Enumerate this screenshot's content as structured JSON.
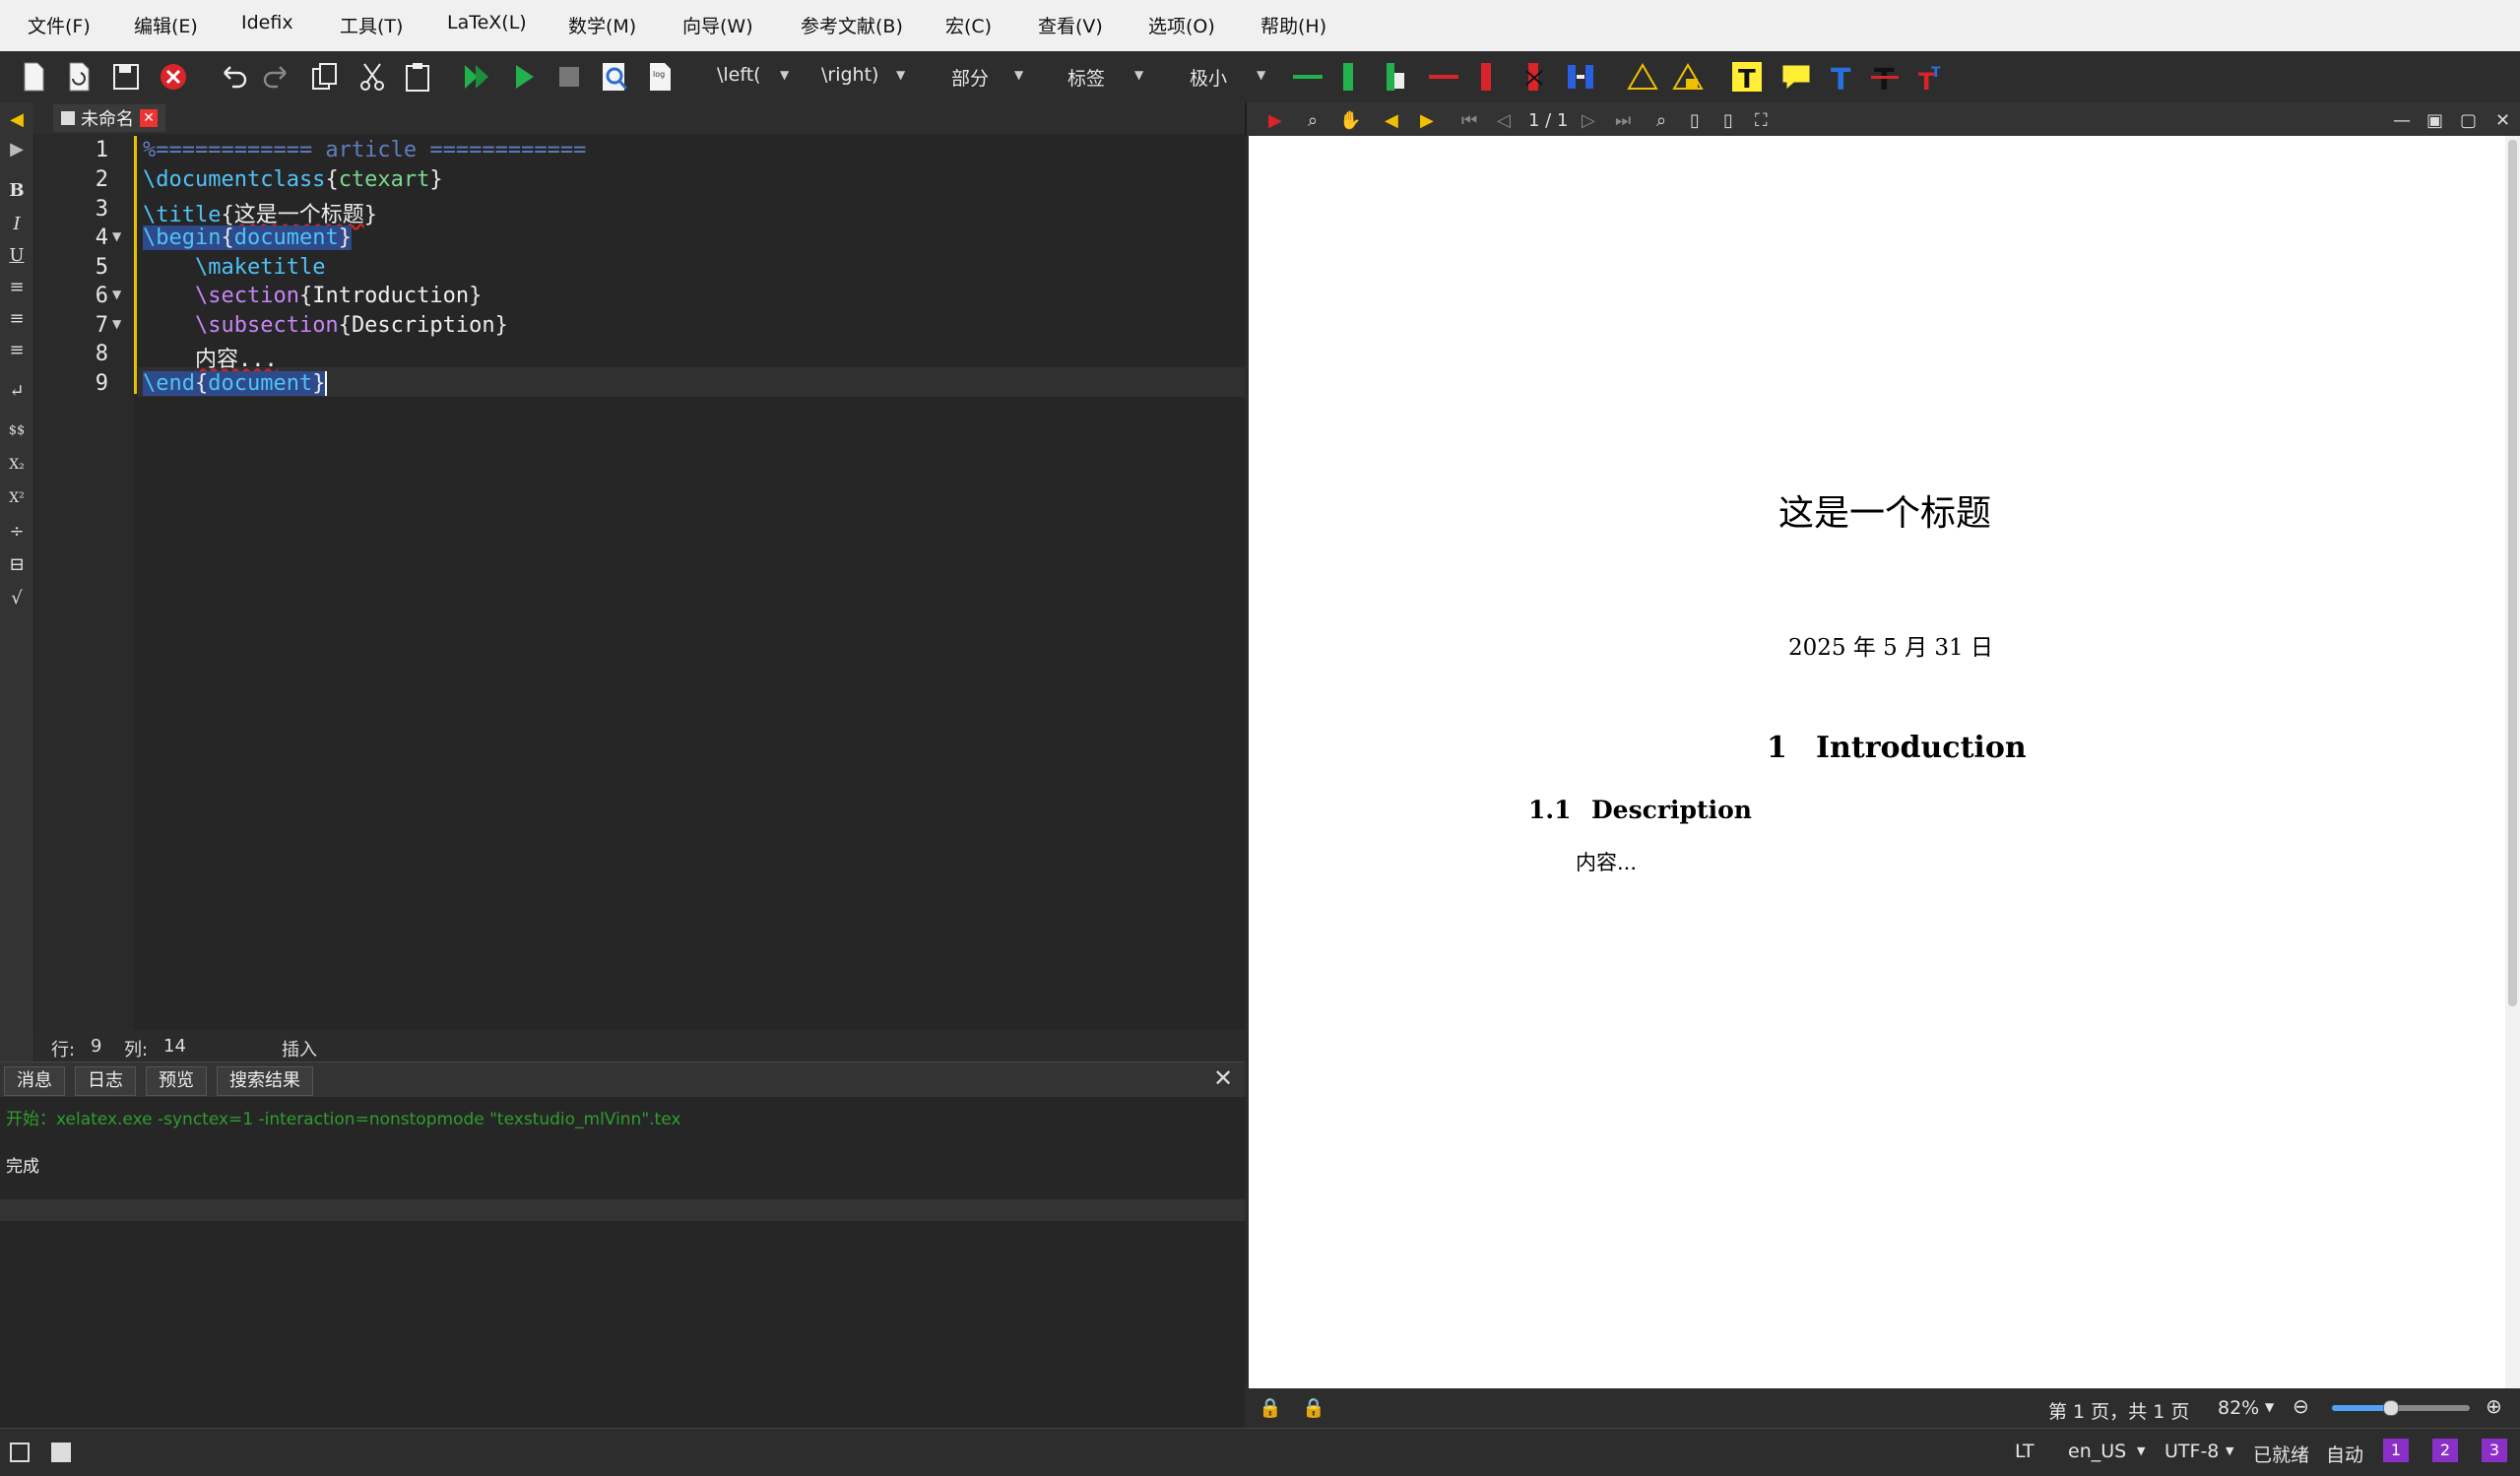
{
  "menu": [
    "文件(F)",
    "编辑(E)",
    "Idefix",
    "工具(T)",
    "LaTeX(L)",
    "数学(M)",
    "向导(W)",
    "参考文献(B)",
    "宏(C)",
    "查看(V)",
    "选项(O)",
    "帮助(H)"
  ],
  "toolbar": {
    "left_delim": "\\left(",
    "right_delim": "\\right)",
    "section_combo": "部分",
    "label_combo": "标签",
    "size_combo": "极小"
  },
  "editor": {
    "tab_title": "未命名",
    "lines": [
      "1",
      "2",
      "3",
      "4",
      "5",
      "6",
      "7",
      "8",
      "9"
    ],
    "code": {
      "l1": "%============ article ============",
      "l2_cmd": "\\documentclass",
      "l2_arg": "ctexart",
      "l3_cmd": "\\title",
      "l3_arg": "这是一个标题",
      "l4_cmd": "\\begin",
      "l4_arg": "document",
      "l5_cmd": "\\maketitle",
      "l6_cmd": "\\section",
      "l6_arg": "Introduction",
      "l7_cmd": "\\subsection",
      "l7_arg": "Description",
      "l8_text": "内容...",
      "l9_cmd": "\\end",
      "l9_arg": "document"
    },
    "status": {
      "row_label": "行:",
      "row": "9",
      "col_label": "列:",
      "col": "14",
      "mode": "插入"
    }
  },
  "messages": {
    "tabs": [
      "消息",
      "日志",
      "预览",
      "搜索结果"
    ],
    "log_start": "开始：xelatex.exe -synctex=1 -interaction=nonstopmode \"texstudio_mlVinn\".tex",
    "log_done": "完成"
  },
  "viewer": {
    "page_indicator": "1 / 1",
    "doc": {
      "title": "这是一个标题",
      "date": "2025 年 5 月 31 日",
      "section_num": "1",
      "section_title": "Introduction",
      "subsection_num": "1.1",
      "subsection_title": "Description",
      "body": "内容..."
    },
    "status": {
      "page_info": "第 1 页，共 1 页",
      "zoom": "82%",
      "zoom_fraction": 0.42
    }
  },
  "statusbar": {
    "lt": "LT",
    "lang": "en_US",
    "encoding": "UTF-8",
    "ready": "已就绪",
    "auto": "自动",
    "b1": "1",
    "b2": "2",
    "b3": "3"
  },
  "colors": {
    "accent": "#4fc3f7",
    "keyword": "#c586f6",
    "arg": "#7bd88f",
    "log_green": "#2e9e2e"
  }
}
